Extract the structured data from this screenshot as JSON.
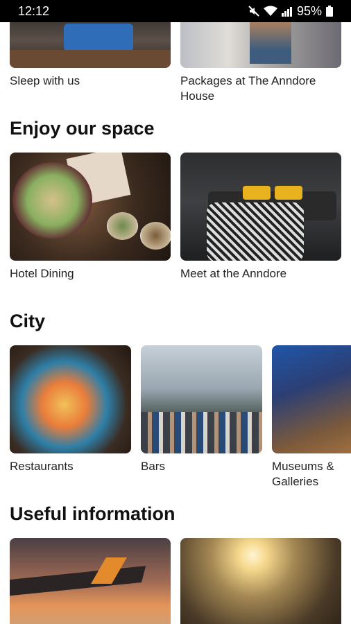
{
  "status": {
    "time": "12:12",
    "battery": "95%",
    "icons": [
      "mute-icon",
      "wifi-icon",
      "signal-icon",
      "battery-icon"
    ]
  },
  "top_cards": [
    {
      "label": "Sleep with us"
    },
    {
      "label": "Packages at The Anndore House"
    }
  ],
  "sections": {
    "space": {
      "title": "Enjoy our space",
      "cards": [
        {
          "label": "Hotel Dining"
        },
        {
          "label": "Meet at the Anndore"
        }
      ]
    },
    "city": {
      "title": "City",
      "cards": [
        {
          "label": "Restaurants"
        },
        {
          "label": "Bars"
        },
        {
          "label": "Museums & Galleries"
        }
      ]
    },
    "useful": {
      "title": "Useful information"
    }
  }
}
